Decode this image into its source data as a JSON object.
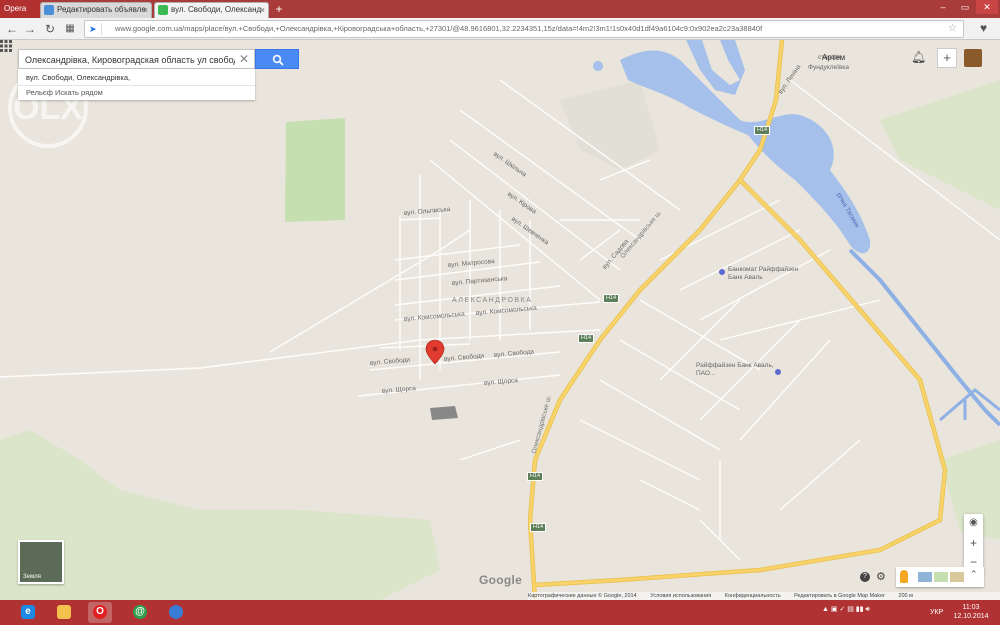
{
  "browser": {
    "menu_label": "Opera",
    "tabs": [
      {
        "label": "Редактировать объявле",
        "active": false
      },
      {
        "label": "вул. Свободи, Олександ",
        "active": true
      }
    ],
    "new_tab": "+",
    "url": "www.google.com.ua/maps/place/вул.+Свободи,+Олександрівка,+Кіровоградська+область,+27301/@48.9616801,32.2234351,15z/data=!4m2!3m1!1s0x40d1df49a6104c9:0x902ea2c23a38840f",
    "window_controls": [
      "–",
      "▭",
      "✕"
    ]
  },
  "search": {
    "query": "Олександрівка, Кировоградская область ул свобода",
    "clear_glyph": "✕",
    "result_address": "вул. Свободи, Олександрівка,",
    "links": "Рельєф  Искать рядом"
  },
  "account": {
    "user_name": "Артем",
    "plus_label": "+"
  },
  "map_labels": [
    {
      "key": "town",
      "text": "АЛЕКСАНДРОВКА"
    },
    {
      "key": "bank1",
      "text": "Банкомат Райффайзен Банк Аваль"
    },
    {
      "key": "bank2",
      "text": "Райффайзен Банк Аваль, ПАО..."
    },
    {
      "key": "street1",
      "text": "вул. Свободи"
    },
    {
      "key": "street2",
      "text": "вул. Свободи"
    },
    {
      "key": "street3",
      "text": "вул. Свобода"
    },
    {
      "key": "street4",
      "text": "вул. Щорса"
    },
    {
      "key": "street5",
      "text": "вул. Щорса"
    },
    {
      "key": "street6",
      "text": "вул. Партизанська"
    },
    {
      "key": "street7",
      "text": "вул. Матросова"
    },
    {
      "key": "street8",
      "text": "вул. Комсомольська"
    },
    {
      "key": "street9",
      "text": "вул. Комсомольська"
    },
    {
      "key": "street10",
      "text": "вул. Ольгівська"
    },
    {
      "key": "street11",
      "text": "вул. Шевченка"
    },
    {
      "key": "street12",
      "text": "вул. Кірова"
    },
    {
      "key": "street13",
      "text": "вул. Садова"
    },
    {
      "key": "street14",
      "text": "вул. Леніна"
    },
    {
      "key": "street15",
      "text": "вул. Шкільна"
    },
    {
      "key": "street16",
      "text": "Олександрівське ш."
    },
    {
      "key": "street17",
      "text": "Олександрівське ш."
    },
    {
      "key": "river",
      "text": "річка Тясмин"
    },
    {
      "key": "poi1",
      "text": "Фундуклеївка"
    },
    {
      "key": "poi2",
      "text": "станція"
    }
  ],
  "road_shields": [
    "H14",
    "H14",
    "H14",
    "H14",
    "H14"
  ],
  "map_controls": {
    "zoom_in": "+",
    "zoom_out": "−",
    "earth_label": "Земля",
    "google_logo": "Google",
    "help": "?"
  },
  "footer": [
    "Картографические данные © Google, 2014",
    "Условия использования",
    "Конфиденциальность",
    "Редактировать в Google Map Maker",
    "200 м"
  ],
  "watermark": "OLX",
  "taskbar": {
    "language": "УКР",
    "time": "11:03",
    "date": "12.10.2014"
  },
  "colors": {
    "map_bg": "#e9e5dc",
    "water": "#a5c0ea",
    "park": "#c6dfb0",
    "highway": "#f7d36a",
    "search_blue": "#4a8af4",
    "taskbar": "#b03232"
  }
}
